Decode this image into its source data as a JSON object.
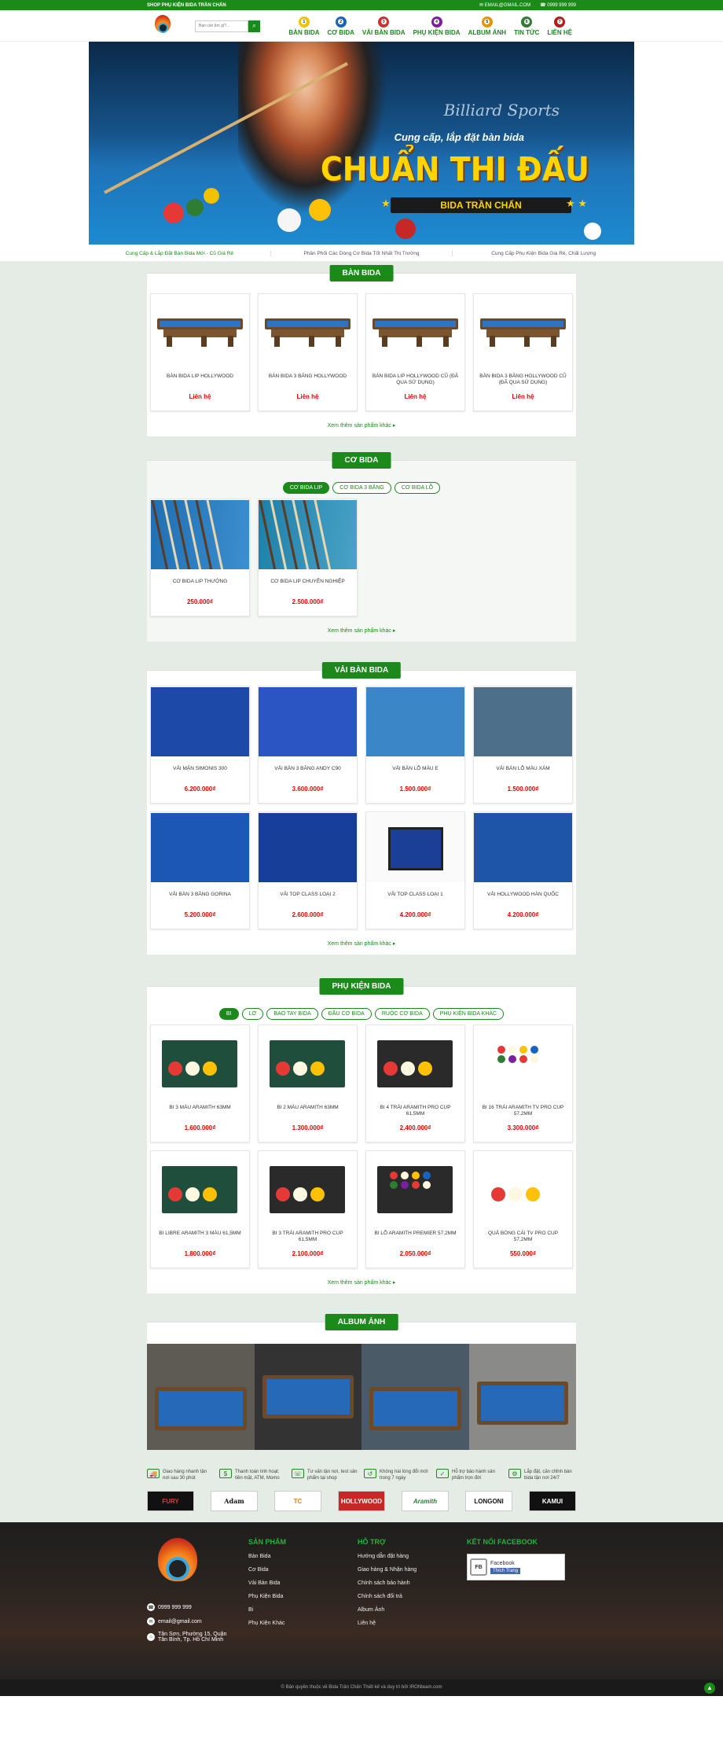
{
  "topbar": {
    "shop_name": "SHOP PHỤ KIỆN BIDA TRẦN CHẤN",
    "email": "EMAIL@GMAIL.COM",
    "phone": "0999 999 999"
  },
  "header": {
    "search_placeholder": "Bạn cần tìm gì?...",
    "nav": [
      {
        "label": "BÀN BIDA",
        "color": "#f2c200",
        "num": "1"
      },
      {
        "label": "CƠ BIDA",
        "color": "#1565c0",
        "num": "2"
      },
      {
        "label": "VẢI BÀN BIDA",
        "color": "#d32f2f",
        "num": "3"
      },
      {
        "label": "PHỤ KIỆN BIDA",
        "color": "#7b1fa2",
        "num": "4"
      },
      {
        "label": "ALBUM ẢNH",
        "color": "#e69500",
        "num": "5"
      },
      {
        "label": "TIN TỨC",
        "color": "#2e7d32",
        "num": "6"
      },
      {
        "label": "LIÊN HỆ",
        "color": "#b71c1c",
        "num": "7"
      }
    ]
  },
  "banner": {
    "script": "Billiard Sports",
    "line1": "Cung cấp, lắp đặt bàn bida",
    "line2": "CHUẨN THI ĐẤU",
    "line3": "BIDA TRẦN CHẤN"
  },
  "promo": [
    "Cung Cấp & Lắp Đặt Bàn Bida Mới - Cũ Giá Rẻ",
    "Phân Phối Các Dòng Cơ Bida Tốt Nhất Thị Trường",
    "Cung Cấp Phụ Kiện Bida Giá Rẻ, Chất Lượng"
  ],
  "more_label": "Xem thêm sản phẩm khác ▸",
  "tables": {
    "title": "BÀN BIDA",
    "items": [
      {
        "name": "BÀN BIDA LIP HOLLYWOOD",
        "price": "Liên hệ"
      },
      {
        "name": "BÀN BIDA 3 BĂNG HOLLYWOOD",
        "price": "Liên hệ"
      },
      {
        "name": "BÀN BIDA LIP HOLLYWOOD CŨ (ĐÃ QUA SỬ DỤNG)",
        "price": "Liên hệ"
      },
      {
        "name": "BÀN BIDA 3 BĂNG HOLLYWOOD CŨ (ĐÃ QUA SỬ DỤNG)",
        "price": "Liên hệ"
      }
    ]
  },
  "cues": {
    "title": "CƠ BIDA",
    "tabs": [
      "CƠ BIDA LIP",
      "CƠ BIDA 3 BĂNG",
      "CƠ BIDA LỖ"
    ],
    "items": [
      {
        "name": "CƠ BIDA LIP THƯỜNG",
        "price": "250.000₫"
      },
      {
        "name": "CƠ BIDA LIP CHUYÊN NGHIỆP",
        "price": "2.500.000₫"
      }
    ]
  },
  "cloth": {
    "title": "VẢI BÀN BIDA",
    "items": [
      {
        "name": "VẢI MẶN SIMONIS 300",
        "price": "6.200.000₫"
      },
      {
        "name": "VẢI BÀN 3 BĂNG ANDY C90",
        "price": "3.600.000₫"
      },
      {
        "name": "VẢI BÀN LỖ MÀU E",
        "price": "1.500.000₫"
      },
      {
        "name": "VẢI BÀN LỖ MÀU XÁM",
        "price": "1.500.000₫"
      },
      {
        "name": "VẢI BÀN 3 BĂNG GORINA",
        "price": "5.200.000₫"
      },
      {
        "name": "VẢI TOP CLASS LOẠI 2",
        "price": "2.600.000₫"
      },
      {
        "name": "VẢI TOP CLASS LOẠI 1",
        "price": "4.200.000₫"
      },
      {
        "name": "VẢI HOLLYWOOD HÀN QUỐC",
        "price": "4.200.000₫"
      }
    ]
  },
  "accessories": {
    "title": "PHỤ KIỆN BIDA",
    "tabs": [
      "BI",
      "LƠ",
      "BAO TAY BIDA",
      "ĐẦU CƠ BIDA",
      "RUỘC CƠ BIDA",
      "PHỤ KIỆN BIDA KHÁC"
    ],
    "items": [
      {
        "name": "BI 3 MÀU ARAMITH 63MM",
        "price": "1.600.000₫"
      },
      {
        "name": "BI 2 MÀU ARAMITH 63MM",
        "price": "1.300.000₫"
      },
      {
        "name": "BI 4 TRÁI ARAMITH PRO CUP 61,5MM",
        "price": "2.400.000₫"
      },
      {
        "name": "BI 16 TRÁI ARAMITH TV PRO CUP 57,2MM",
        "price": "3.300.000₫"
      },
      {
        "name": "BI LIBRE ARAMITH 3 MÀU 61,5MM",
        "price": "1.800.000₫"
      },
      {
        "name": "BI 3 TRÁI ARAMITH PRO CUP 61,5MM",
        "price": "2.100.000₫"
      },
      {
        "name": "BI LỖ ARAMITH PREMIER 57,2MM",
        "price": "2.050.000₫"
      },
      {
        "name": "QUẢ BÓNG CÁI TV PRO CUP 57,2MM",
        "price": "550.000₫"
      }
    ]
  },
  "album": {
    "title": "ALBUM ẢNH"
  },
  "features": [
    "Giao hàng nhanh tận nơi sau 30 phút",
    "Thanh toán linh hoạt: tiền mặt, ATM, Momo",
    "Tư vấn tận nơi, test sản phẩm tại shop",
    "Không hài lòng đổi mới trong 7 ngày",
    "Hỗ trợ bảo hành sản phẩm trọn đời",
    "Lắp đặt, căn chỉnh bàn bida tận nơi 24/7"
  ],
  "brands": [
    "FURY",
    "Adam",
    "TC",
    "HOLLYWOOD",
    "Aramith",
    "LONGONI",
    "KAMUI"
  ],
  "footer": {
    "contact": [
      "0999 999 999",
      "email@gmail.com",
      "Tân Sơn, Phường 15, Quận Tân Bình, Tp. Hồ Chí Minh"
    ],
    "col1_title": "SẢN PHẨM",
    "col1": [
      "Bàn Bida",
      "Cơ Bida",
      "Vải Bàn Bida",
      "Phụ Kiện Bida",
      "Bi",
      "Phụ Kiện Khác"
    ],
    "col2_title": "HỖ TRỢ",
    "col2": [
      "Hướng dẫn đặt hàng",
      "Giao hàng & Nhận hàng",
      "Chính sách bảo hành",
      "Chính sách đổi trả",
      "Album Ảnh",
      "Liên hệ"
    ],
    "col3_title": "KẾT NỐI FACEBOOK",
    "fb_name": "Facebook",
    "fb_like": "Thích Trang",
    "copyright": "© Bản quyền thuộc về Bida Trần Chấn Thiết kế và duy trì bởi IRONteam.com"
  }
}
